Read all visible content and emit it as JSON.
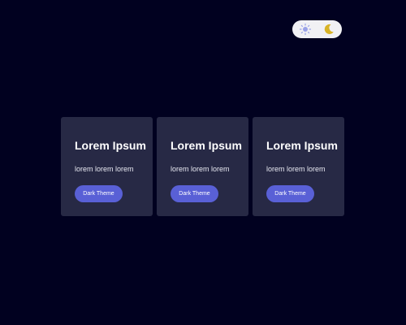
{
  "theme_toggle": {
    "light_icon": "sun-icon",
    "dark_icon": "moon-icon",
    "light_color": "#9aa2e8",
    "dark_color": "#d8b326",
    "track_color": "#f1f1f4"
  },
  "cards": [
    {
      "title": "Lorem Ipsum",
      "text": "lorem lorem lorem",
      "button_label": "Dark Theme"
    },
    {
      "title": "Lorem Ipsum",
      "text": "lorem lorem lorem",
      "button_label": "Dark Theme"
    },
    {
      "title": "Lorem Ipsum",
      "text": "lorem lorem lorem",
      "button_label": "Dark Theme"
    }
  ],
  "colors": {
    "page_background": "#010120",
    "card_background": "#272945",
    "button_background": "#5960d6"
  }
}
